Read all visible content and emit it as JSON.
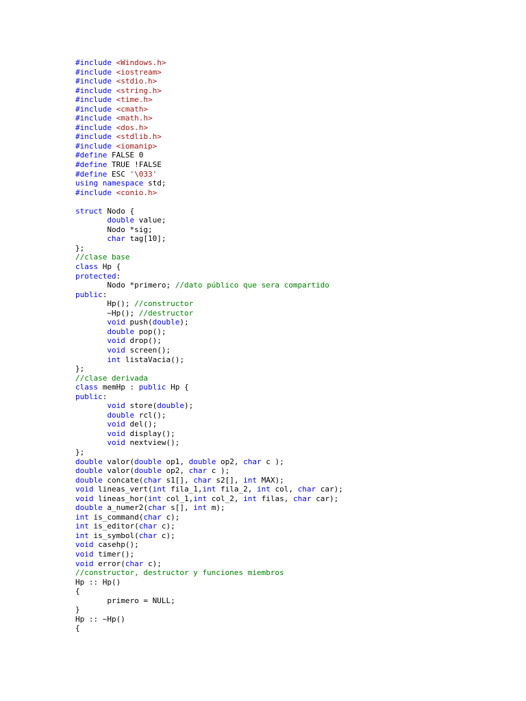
{
  "document": {
    "colors": {
      "keyword": "#0000ff",
      "preprocessor": "#0000ff",
      "string": "#a31515",
      "comment": "#008000",
      "plain": "#000000"
    },
    "lines": [
      [
        [
          "pp",
          "#include "
        ],
        [
          "str",
          "<Windows.h>"
        ]
      ],
      [
        [
          "pp",
          "#include "
        ],
        [
          "str",
          "<iostream>"
        ]
      ],
      [
        [
          "pp",
          "#include "
        ],
        [
          "str",
          "<stdio.h>"
        ]
      ],
      [
        [
          "pp",
          "#include "
        ],
        [
          "str",
          "<string.h>"
        ]
      ],
      [
        [
          "pp",
          "#include "
        ],
        [
          "str",
          "<time.h>"
        ]
      ],
      [
        [
          "pp",
          "#include "
        ],
        [
          "str",
          "<cmath>"
        ]
      ],
      [
        [
          "pp",
          "#include "
        ],
        [
          "str",
          "<math.h>"
        ]
      ],
      [
        [
          "pp",
          "#include "
        ],
        [
          "str",
          "<dos.h>"
        ]
      ],
      [
        [
          "pp",
          "#include "
        ],
        [
          "str",
          "<stdlib.h>"
        ]
      ],
      [
        [
          "pp",
          "#include "
        ],
        [
          "str",
          "<iomanip>"
        ]
      ],
      [
        [
          "pp",
          "#define "
        ],
        [
          "plain",
          "FALSE 0"
        ]
      ],
      [
        [
          "pp",
          "#define "
        ],
        [
          "plain",
          "TRUE !FALSE"
        ]
      ],
      [
        [
          "pp",
          "#define "
        ],
        [
          "plain",
          "ESC "
        ],
        [
          "str",
          "'\\033'"
        ]
      ],
      [
        [
          "kw",
          "using namespace "
        ],
        [
          "plain",
          "std;"
        ]
      ],
      [
        [
          "pp",
          "#include "
        ],
        [
          "str",
          "<conio.h>"
        ]
      ],
      [],
      [
        [
          "kw",
          "struct "
        ],
        [
          "plain",
          "Nodo {"
        ]
      ],
      [
        [
          "plain",
          "       "
        ],
        [
          "kw",
          "double "
        ],
        [
          "plain",
          "value;"
        ]
      ],
      [
        [
          "plain",
          "       Nodo *sig;"
        ]
      ],
      [
        [
          "plain",
          "       "
        ],
        [
          "kw",
          "char "
        ],
        [
          "plain",
          "tag[10];"
        ]
      ],
      [
        [
          "plain",
          "};"
        ]
      ],
      [
        [
          "com",
          "//clase base"
        ]
      ],
      [
        [
          "kw",
          "class "
        ],
        [
          "plain",
          "Hp {"
        ]
      ],
      [
        [
          "kw",
          "protected"
        ],
        [
          "plain",
          ":"
        ]
      ],
      [
        [
          "plain",
          "       Nodo *primero; "
        ],
        [
          "com",
          "//dato público que sera compartido"
        ]
      ],
      [
        [
          "kw",
          "public"
        ],
        [
          "plain",
          ":"
        ]
      ],
      [
        [
          "plain",
          "       Hp(); "
        ],
        [
          "com",
          "//constructor"
        ]
      ],
      [
        [
          "plain",
          "       ~Hp(); "
        ],
        [
          "com",
          "//destructor"
        ]
      ],
      [
        [
          "plain",
          "       "
        ],
        [
          "kw",
          "void "
        ],
        [
          "plain",
          "push("
        ],
        [
          "kw",
          "double"
        ],
        [
          "plain",
          ");"
        ]
      ],
      [
        [
          "plain",
          "       "
        ],
        [
          "kw",
          "double "
        ],
        [
          "plain",
          "pop();"
        ]
      ],
      [
        [
          "plain",
          "       "
        ],
        [
          "kw",
          "void "
        ],
        [
          "plain",
          "drop();"
        ]
      ],
      [
        [
          "plain",
          "       "
        ],
        [
          "kw",
          "void "
        ],
        [
          "plain",
          "screen();"
        ]
      ],
      [
        [
          "plain",
          "       "
        ],
        [
          "kw",
          "int "
        ],
        [
          "plain",
          "listaVacia();"
        ]
      ],
      [
        [
          "plain",
          "};"
        ]
      ],
      [
        [
          "com",
          "//clase derivada"
        ]
      ],
      [
        [
          "kw",
          "class "
        ],
        [
          "plain",
          "memHp : "
        ],
        [
          "kw",
          "public "
        ],
        [
          "plain",
          "Hp {"
        ]
      ],
      [
        [
          "kw",
          "public"
        ],
        [
          "plain",
          ":"
        ]
      ],
      [
        [
          "plain",
          "       "
        ],
        [
          "kw",
          "void "
        ],
        [
          "plain",
          "store("
        ],
        [
          "kw",
          "double"
        ],
        [
          "plain",
          ");"
        ]
      ],
      [
        [
          "plain",
          "       "
        ],
        [
          "kw",
          "double "
        ],
        [
          "plain",
          "rcl();"
        ]
      ],
      [
        [
          "plain",
          "       "
        ],
        [
          "kw",
          "void "
        ],
        [
          "plain",
          "del();"
        ]
      ],
      [
        [
          "plain",
          "       "
        ],
        [
          "kw",
          "void "
        ],
        [
          "plain",
          "display();"
        ]
      ],
      [
        [
          "plain",
          "       "
        ],
        [
          "kw",
          "void "
        ],
        [
          "plain",
          "nextview();"
        ]
      ],
      [
        [
          "plain",
          "};"
        ]
      ],
      [
        [
          "kw",
          "double "
        ],
        [
          "plain",
          "valor("
        ],
        [
          "kw",
          "double "
        ],
        [
          "plain",
          "op1, "
        ],
        [
          "kw",
          "double "
        ],
        [
          "plain",
          "op2, "
        ],
        [
          "kw",
          "char "
        ],
        [
          "plain",
          "c );"
        ]
      ],
      [
        [
          "kw",
          "double "
        ],
        [
          "plain",
          "valor("
        ],
        [
          "kw",
          "double "
        ],
        [
          "plain",
          "op2, "
        ],
        [
          "kw",
          "char "
        ],
        [
          "plain",
          "c );"
        ]
      ],
      [
        [
          "kw",
          "double "
        ],
        [
          "plain",
          "concate("
        ],
        [
          "kw",
          "char "
        ],
        [
          "plain",
          "s1[], "
        ],
        [
          "kw",
          "char "
        ],
        [
          "plain",
          "s2[], "
        ],
        [
          "kw",
          "int "
        ],
        [
          "plain",
          "MAX);"
        ]
      ],
      [
        [
          "kw",
          "void "
        ],
        [
          "plain",
          "lineas_vert("
        ],
        [
          "kw",
          "int "
        ],
        [
          "plain",
          "fila_1,"
        ],
        [
          "kw",
          "int "
        ],
        [
          "plain",
          "fila_2, "
        ],
        [
          "kw",
          "int "
        ],
        [
          "plain",
          "col, "
        ],
        [
          "kw",
          "char "
        ],
        [
          "plain",
          "car);"
        ]
      ],
      [
        [
          "kw",
          "void "
        ],
        [
          "plain",
          "lineas_hor("
        ],
        [
          "kw",
          "int "
        ],
        [
          "plain",
          "col_1,"
        ],
        [
          "kw",
          "int "
        ],
        [
          "plain",
          "col_2, "
        ],
        [
          "kw",
          "int "
        ],
        [
          "plain",
          "filas, "
        ],
        [
          "kw",
          "char "
        ],
        [
          "plain",
          "car);"
        ]
      ],
      [
        [
          "kw",
          "double "
        ],
        [
          "plain",
          "a_numer2("
        ],
        [
          "kw",
          "char "
        ],
        [
          "plain",
          "s[], "
        ],
        [
          "kw",
          "int "
        ],
        [
          "plain",
          "m);"
        ]
      ],
      [
        [
          "kw",
          "int "
        ],
        [
          "plain",
          "is_command("
        ],
        [
          "kw",
          "char "
        ],
        [
          "plain",
          "c);"
        ]
      ],
      [
        [
          "kw",
          "int "
        ],
        [
          "plain",
          "is_editor("
        ],
        [
          "kw",
          "char "
        ],
        [
          "plain",
          "c);"
        ]
      ],
      [
        [
          "kw",
          "int "
        ],
        [
          "plain",
          "is_symbol("
        ],
        [
          "kw",
          "char "
        ],
        [
          "plain",
          "c);"
        ]
      ],
      [
        [
          "kw",
          "void "
        ],
        [
          "plain",
          "casehp();"
        ]
      ],
      [
        [
          "kw",
          "void "
        ],
        [
          "plain",
          "timer();"
        ]
      ],
      [
        [
          "kw",
          "void "
        ],
        [
          "plain",
          "error("
        ],
        [
          "kw",
          "char "
        ],
        [
          "plain",
          "c);"
        ]
      ],
      [
        [
          "com",
          "//constructor, destructor y funciones miembros"
        ]
      ],
      [
        [
          "plain",
          "Hp :: Hp()"
        ]
      ],
      [
        [
          "plain",
          "{"
        ]
      ],
      [
        [
          "plain",
          "       primero = NULL;"
        ]
      ],
      [
        [
          "plain",
          "}"
        ]
      ],
      [
        [
          "plain",
          "Hp :: ~Hp()"
        ]
      ],
      [
        [
          "plain",
          "{"
        ]
      ]
    ]
  }
}
